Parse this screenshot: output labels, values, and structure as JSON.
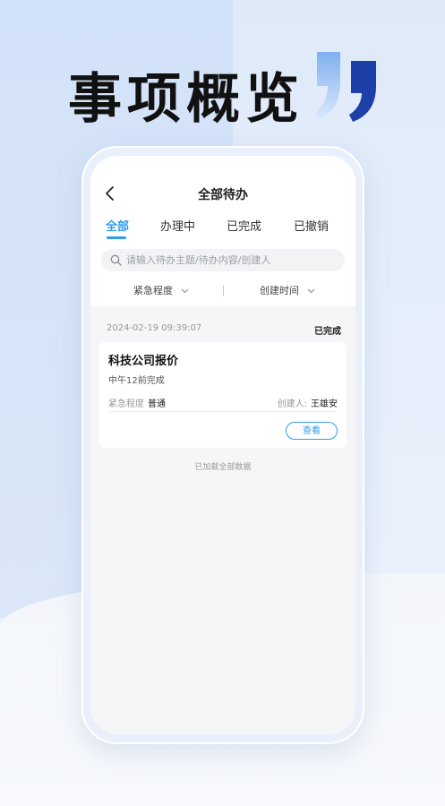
{
  "headline": "事项概览",
  "colors": {
    "accent": "#2f9bec",
    "quote_dark": "#1f3fa8",
    "quote_light": "#9fc3f2"
  },
  "icons": {
    "back": "chevron-left-icon",
    "search": "search-icon",
    "quote": "quote-mark-icon",
    "dropdown": "chevron-down-icon"
  },
  "nav": {
    "title": "全部待办"
  },
  "tabs": [
    {
      "label": "全部",
      "active": true
    },
    {
      "label": "办理中",
      "active": false
    },
    {
      "label": "已完成",
      "active": false
    },
    {
      "label": "已撤销",
      "active": false
    }
  ],
  "search": {
    "placeholder": "请输入待办主题/待办内容/创建人"
  },
  "filters": [
    {
      "label": "紧急程度"
    },
    {
      "label": "创建时间"
    }
  ],
  "items": [
    {
      "date": "2024-02-19 09:39:07",
      "status": "已完成",
      "title": "科技公司报价",
      "content": "中午12前完成",
      "urgency_label": "紧急程度",
      "urgency_value": "普通",
      "creator_label": "创建人:",
      "creator_value": "王雄安",
      "view_label": "查看"
    }
  ],
  "footer": {
    "loaded_text": "已加载全部数据"
  }
}
